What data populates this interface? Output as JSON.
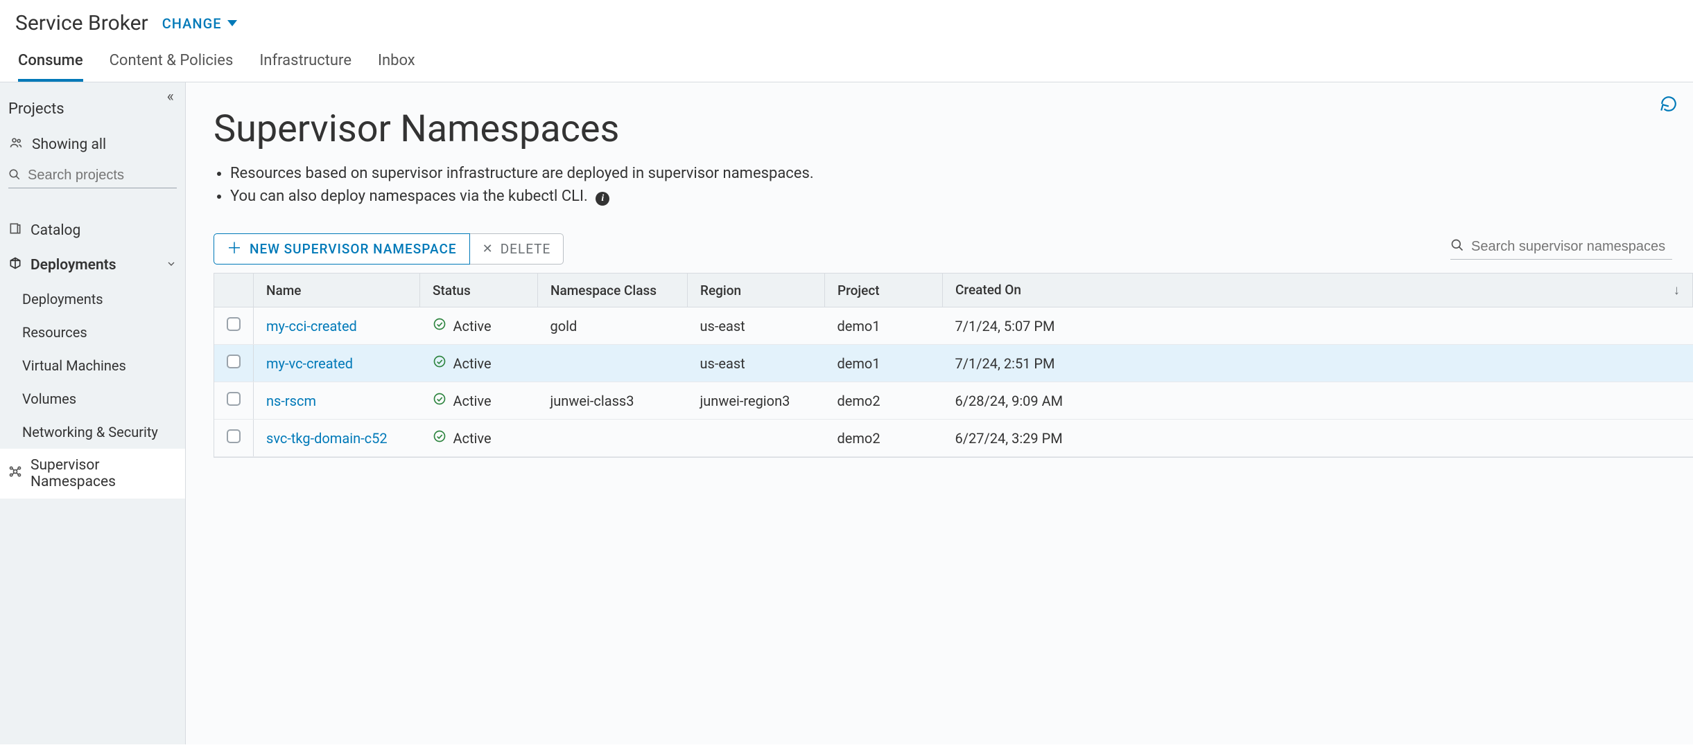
{
  "app": {
    "title": "Service Broker",
    "change_label": "CHANGE"
  },
  "tabs": {
    "consume": "Consume",
    "content_policies": "Content & Policies",
    "infrastructure": "Infrastructure",
    "inbox": "Inbox"
  },
  "sidebar": {
    "projects_title": "Projects",
    "showing_all": "Showing all",
    "search_placeholder": "Search projects",
    "catalog": "Catalog",
    "deployments_parent": "Deployments",
    "deployments": "Deployments",
    "resources": "Resources",
    "virtual_machines": "Virtual Machines",
    "volumes": "Volumes",
    "networking_security": "Networking & Security",
    "supervisor_namespaces": "Supervisor Namespaces"
  },
  "page": {
    "title": "Supervisor Namespaces",
    "desc_line1": "Resources based on supervisor infrastructure are deployed in supervisor namespaces.",
    "desc_line2": "You can also deploy namespaces via the kubectl CLI."
  },
  "toolbar": {
    "new_label": "NEW SUPERVISOR NAMESPACE",
    "delete_label": "DELETE",
    "search_placeholder": "Search supervisor namespaces"
  },
  "columns": {
    "name": "Name",
    "status": "Status",
    "namespace_class": "Namespace Class",
    "region": "Region",
    "project": "Project",
    "created_on": "Created On"
  },
  "status_active": "Active",
  "rows": [
    {
      "name": "my-cci-created",
      "status": "Active",
      "namespace_class": "gold",
      "region": "us-east",
      "project": "demo1",
      "created_on": "7/1/24, 5:07 PM"
    },
    {
      "name": "my-vc-created",
      "status": "Active",
      "namespace_class": "",
      "region": "us-east",
      "project": "demo1",
      "created_on": "7/1/24, 2:51 PM"
    },
    {
      "name": "ns-rscm",
      "status": "Active",
      "namespace_class": "junwei-class3",
      "region": "junwei-region3",
      "project": "demo2",
      "created_on": "6/28/24, 9:09 AM"
    },
    {
      "name": "svc-tkg-domain-c52",
      "status": "Active",
      "namespace_class": "",
      "region": "",
      "project": "demo2",
      "created_on": "6/27/24, 3:29 PM"
    }
  ]
}
